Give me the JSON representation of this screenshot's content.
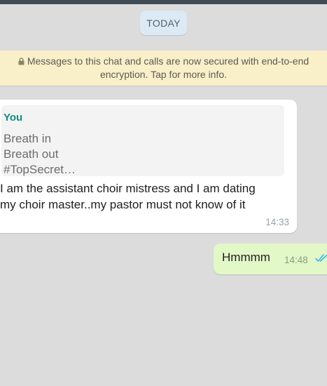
{
  "chat": {
    "date_chip": "TODAY",
    "encryption_notice_line1": "Messages to this chat and calls are now secured with end-to-end",
    "encryption_notice_line2": "encryption. Tap for more info.",
    "icons": {
      "encryption": "lock-icon",
      "read_receipt": "double-check-icon"
    },
    "colors": {
      "chat_background": "#dcdcdc",
      "incoming_bubble": "#ffffff",
      "outgoing_bubble": "#e2f8c6",
      "quote_author": "#0f8f7e",
      "read_ticks": "#34b7f1",
      "notice_background": "#f9efc8"
    }
  },
  "messages": [
    {
      "direction": "incoming",
      "quoted": {
        "author": "You",
        "lines": [
          "Breath in",
          "Breath out",
          "#TopSecret…"
        ]
      },
      "text_lines": [
        "I am the assistant choir mistress and I am dating",
        "my choir master..my pastor must not know of it"
      ],
      "time": "14:33"
    },
    {
      "direction": "outgoing",
      "text": "Hmmmm",
      "time": "14:48",
      "status": "read"
    }
  ]
}
